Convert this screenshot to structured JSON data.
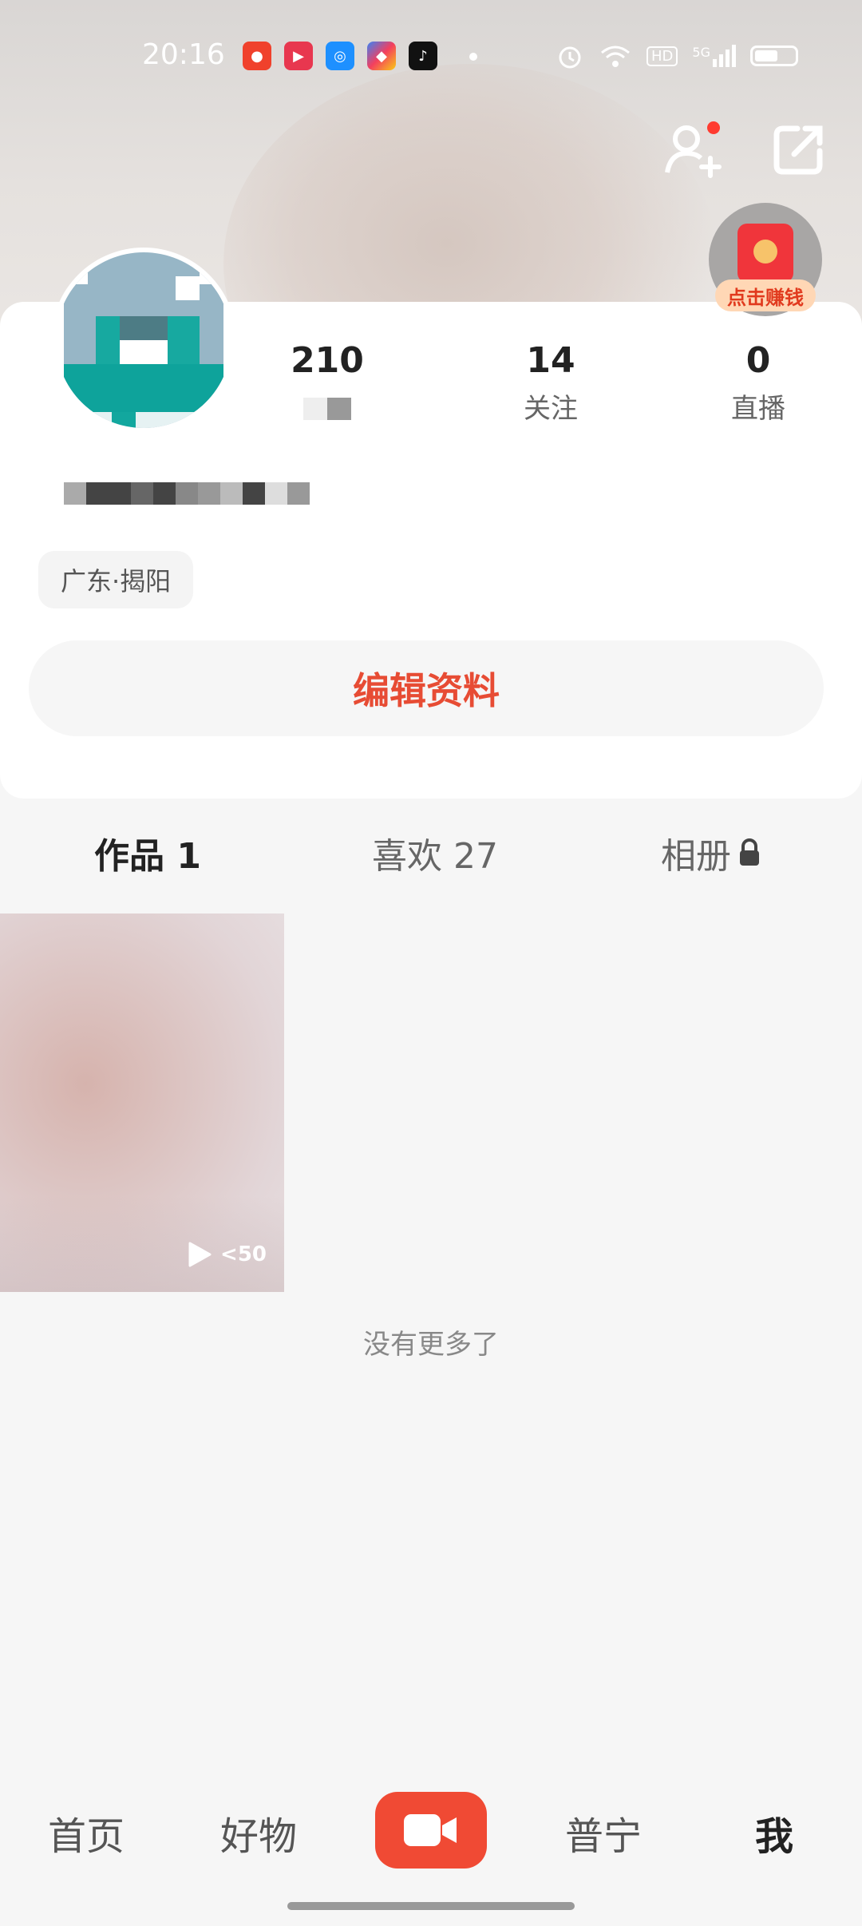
{
  "status_bar": {
    "time": "20:16",
    "notification_apps": [
      "app-icon-1",
      "app-icon-2",
      "app-icon-3",
      "app-icon-4",
      "tiktok-icon"
    ],
    "signal_text": "5G",
    "hd_text": "HD"
  },
  "header": {
    "add_friend_icon": "add-user-icon",
    "share_icon": "share-icon",
    "red_packet_label": "点击赚钱"
  },
  "profile": {
    "stats": [
      {
        "value": "210",
        "label": ""
      },
      {
        "value": "14",
        "label": "关注"
      },
      {
        "value": "0",
        "label": "直播"
      }
    ],
    "location": "广东·揭阳",
    "edit_button": "编辑资料"
  },
  "tabs": [
    {
      "label": "作品 1",
      "active": true
    },
    {
      "label": "喜欢 27",
      "active": false
    },
    {
      "label": "相册",
      "active": false,
      "locked": true
    }
  ],
  "videos": [
    {
      "play_count": "<50"
    }
  ],
  "end_text": "没有更多了",
  "bottom_nav": {
    "items": [
      "首页",
      "好物",
      "普宁",
      "我"
    ],
    "active": "我"
  },
  "colors": {
    "accent": "#f04a34",
    "edit_text": "#e74c34"
  }
}
